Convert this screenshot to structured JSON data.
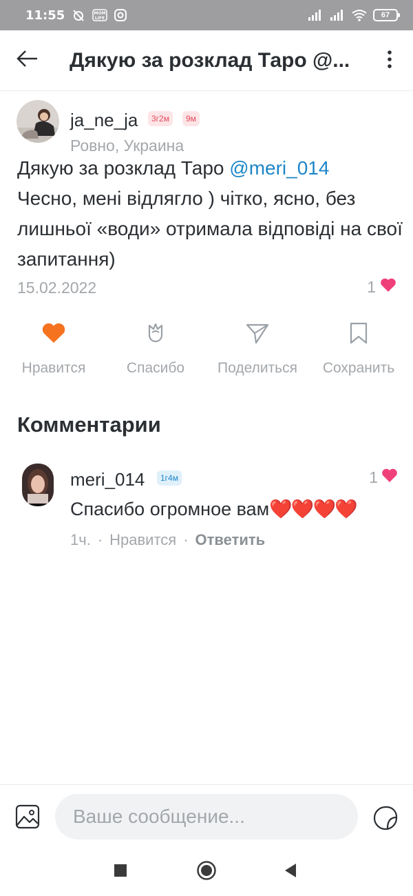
{
  "status_bar": {
    "time": "11:55",
    "battery": "67",
    "icons": [
      "no-alarm-icon",
      "mom-life-icon",
      "instagram-icon",
      "signal-icon",
      "signal-icon",
      "wifi-icon",
      "battery-icon"
    ]
  },
  "header": {
    "title": "Дякую за розклад Таро @...",
    "icons": [
      "back-arrow-icon",
      "more-vertical-icon"
    ]
  },
  "post": {
    "author": {
      "name": "ja_ne_ja",
      "badges": [
        "3г2м",
        "9м"
      ],
      "location": "Ровно, Украина"
    },
    "text_before": "Дякую за розклад Таро ",
    "mention": "@meri_014",
    "text_after": "Чесно, мені відлягло ) чітко, ясно, без лишньої «води» отримала відповіді на свої запитання)",
    "date": "15.02.2022",
    "likes_count": "1"
  },
  "actions": {
    "like": "Нравится",
    "thanks": "Спасибо",
    "share": "Поделиться",
    "save": "Сохранить"
  },
  "comments": {
    "title": "Комментарии",
    "items": [
      {
        "author": "meri_014",
        "badge": "1г4м",
        "likes": "1",
        "text": "Спасибо огромное вам",
        "hearts": "❤️❤️❤️❤️",
        "time": "1ч.",
        "like_label": "Нравится",
        "reply_label": "Ответить"
      }
    ]
  },
  "composer": {
    "placeholder": "Ваше сообщение..."
  },
  "colors": {
    "accent_orange": "#f5731f",
    "mention_blue": "#1d86c8",
    "heart_pink": "#f0407a"
  }
}
